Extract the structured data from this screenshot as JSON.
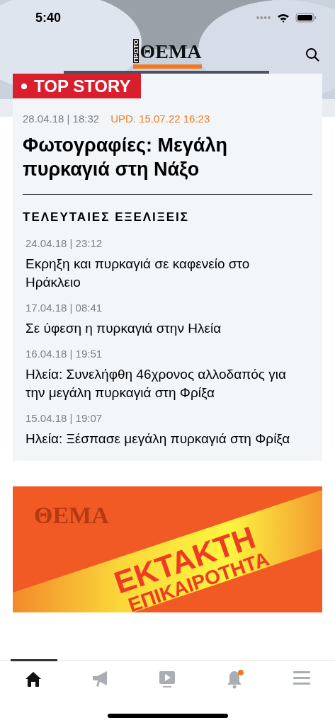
{
  "status_bar": {
    "time": "5:40"
  },
  "header": {
    "logo": {
      "small": "ΠΡΩΤΟ",
      "main": "ΘΕΜΑ"
    }
  },
  "top_story": {
    "badge": "TOP STORY",
    "date": "28.04.18 | 18:32",
    "updated": "UPD. 15.07.22 16:23",
    "title": "Φωτογραφίες: Μεγάλη πυρκαγιά στη Νάξο",
    "section_title": "ΤΕΛΕΥΤΑΙΕΣ ΕΞΕΛΙΞΕΙΣ",
    "updates": [
      {
        "date": "24.04.18 | 23:12",
        "title": "Εκρηξη και πυρκαγιά σε καφενείο στο Ηράκλειο"
      },
      {
        "date": "17.04.18 | 08:41",
        "title": "Σε ύφεση η πυρκαγιά στην Ηλεία"
      },
      {
        "date": "16.04.18 | 19:51",
        "title": "Ηλεία: Συνελήφθη 46χρονος αλλοδαπός για την μεγάλη πυρκαγιά στη Φρίξα"
      },
      {
        "date": "15.04.18 | 19:07",
        "title": "Ηλεία: Ξέσπασε μεγάλη πυρκαγιά στη Φρίξα"
      }
    ]
  },
  "banner": {
    "logo": "ΘΕΜΑ",
    "line_1": "ΕΚΤΑΚΤΗ",
    "line_2": "ΕΠΙΚΑΙΡΟΤΗΤΑ"
  },
  "tab_bar": [
    {
      "kind": "home",
      "selected": true,
      "badge": false
    },
    {
      "kind": "megaphone",
      "selected": false,
      "badge": false
    },
    {
      "kind": "video",
      "selected": false,
      "badge": false
    },
    {
      "kind": "bell",
      "selected": false,
      "badge": true
    },
    {
      "kind": "menu",
      "selected": false,
      "badge": false
    }
  ]
}
